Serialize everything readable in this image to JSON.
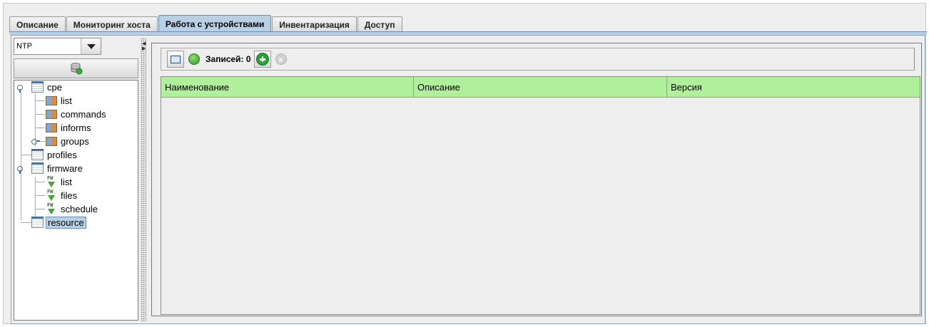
{
  "tabs": [
    {
      "label": "Описание",
      "active": false
    },
    {
      "label": "Мониторинг хоста",
      "active": false
    },
    {
      "label": "Работа с устройствами",
      "active": true
    },
    {
      "label": "Инвентаризация",
      "active": false
    },
    {
      "label": "Доступ",
      "active": false
    }
  ],
  "left_panel": {
    "dropdown_value": "NTP",
    "db_button_icon": "database-refresh-icon"
  },
  "tree": {
    "cpe": "cpe",
    "cpe_list": "list",
    "cpe_commands": "commands",
    "cpe_informs": "informs",
    "cpe_groups": "groups",
    "profiles": "profiles",
    "firmware": "firmware",
    "fw_list": "list",
    "fw_files": "files",
    "fw_schedule": "schedule",
    "resource": "resource",
    "selected": "resource"
  },
  "toolbar": {
    "records_label": "Записей: 0",
    "icons": [
      "fit-icon",
      "refresh-icon",
      "add-icon",
      "delete-icon"
    ]
  },
  "table": {
    "columns": [
      "Наименование",
      "Описание",
      "Версия"
    ],
    "header_color": "#b0f09a",
    "rows": []
  },
  "colors": {
    "selection": "#b8cfe5",
    "header_green": "#b0f09a"
  }
}
